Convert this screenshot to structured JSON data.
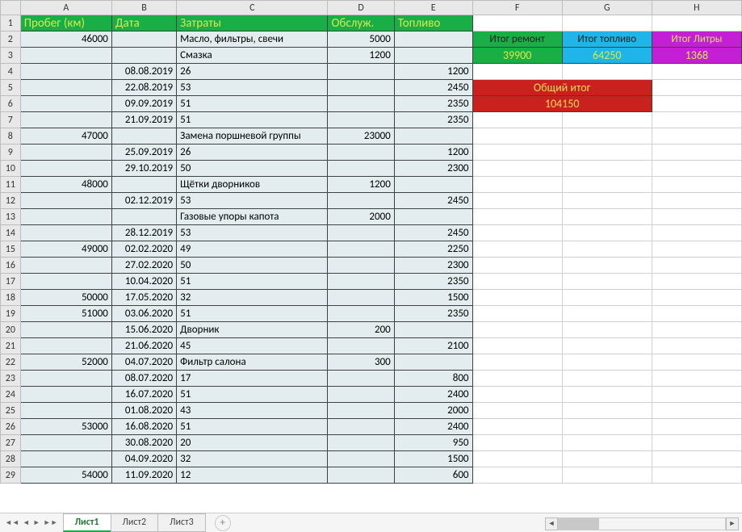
{
  "columns": [
    "A",
    "B",
    "C",
    "D",
    "E",
    "F",
    "G",
    "H"
  ],
  "header": {
    "A": "Пробег (км)",
    "B": "Дата",
    "C": "Затраты",
    "D": "Обслуж.",
    "E": "Топливо"
  },
  "rows": [
    {
      "r": 2,
      "A": "46000",
      "B": "",
      "C": "Масло, фильтры, свечи",
      "D": "5000",
      "E": ""
    },
    {
      "r": 3,
      "A": "",
      "B": "",
      "C": "Смазка",
      "D": "1200",
      "E": ""
    },
    {
      "r": 4,
      "A": "",
      "B": "08.08.2019",
      "C": "26",
      "D": "",
      "E": "1200"
    },
    {
      "r": 5,
      "A": "",
      "B": "22.08.2019",
      "C": "53",
      "D": "",
      "E": "2450"
    },
    {
      "r": 6,
      "A": "",
      "B": "09.09.2019",
      "C": "51",
      "D": "",
      "E": "2350"
    },
    {
      "r": 7,
      "A": "",
      "B": "21.09.2019",
      "C": "51",
      "D": "",
      "E": "2350"
    },
    {
      "r": 8,
      "A": "47000",
      "B": "",
      "C": "Замена поршневой группы",
      "D": "23000",
      "E": ""
    },
    {
      "r": 9,
      "A": "",
      "B": "25.09.2019",
      "C": "26",
      "D": "",
      "E": "1200"
    },
    {
      "r": 10,
      "A": "",
      "B": "29.10.2019",
      "C": "50",
      "D": "",
      "E": "2300"
    },
    {
      "r": 11,
      "A": "48000",
      "B": "",
      "C": "Щётки дворников",
      "D": "1200",
      "E": ""
    },
    {
      "r": 12,
      "A": "",
      "B": "02.12.2019",
      "C": "53",
      "D": "",
      "E": "2450"
    },
    {
      "r": 13,
      "A": "",
      "B": "",
      "C": "Газовые упоры капота",
      "D": "2000",
      "E": ""
    },
    {
      "r": 14,
      "A": "",
      "B": "28.12.2019",
      "C": "53",
      "D": "",
      "E": "2450"
    },
    {
      "r": 15,
      "A": "49000",
      "B": "02.02.2020",
      "C": "49",
      "D": "",
      "E": "2250"
    },
    {
      "r": 16,
      "A": "",
      "B": "27.02.2020",
      "C": "50",
      "D": "",
      "E": "2300"
    },
    {
      "r": 17,
      "A": "",
      "B": "10.04.2020",
      "C": "51",
      "D": "",
      "E": "2350"
    },
    {
      "r": 18,
      "A": "50000",
      "B": "17.05.2020",
      "C": "32",
      "D": "",
      "E": "1500"
    },
    {
      "r": 19,
      "A": "51000",
      "B": "03.06.2020",
      "C": "51",
      "D": "",
      "E": "2350"
    },
    {
      "r": 20,
      "A": "",
      "B": "15.06.2020",
      "C": "Дворник",
      "D": "200",
      "E": ""
    },
    {
      "r": 21,
      "A": "",
      "B": "21.06.2020",
      "C": "45",
      "D": "",
      "E": "2100"
    },
    {
      "r": 22,
      "A": "52000",
      "B": "04.07.2020",
      "C": "Фильтр салона",
      "D": "300",
      "E": ""
    },
    {
      "r": 23,
      "A": "",
      "B": "08.07.2020",
      "C": "17",
      "D": "",
      "E": "800"
    },
    {
      "r": 24,
      "A": "",
      "B": "16.07.2020",
      "C": "51",
      "D": "",
      "E": "2400"
    },
    {
      "r": 25,
      "A": "",
      "B": "01.08.2020",
      "C": "43",
      "D": "",
      "E": "2000"
    },
    {
      "r": 26,
      "A": "53000",
      "B": "16.08.2020",
      "C": "51",
      "D": "",
      "E": "2400"
    },
    {
      "r": 27,
      "A": "",
      "B": "30.08.2020",
      "C": "20",
      "D": "",
      "E": "950"
    },
    {
      "r": 28,
      "A": "",
      "B": "04.09.2020",
      "C": "32",
      "D": "",
      "E": "1500"
    },
    {
      "r": 29,
      "A": "54000",
      "B": "11.09.2020",
      "C": "12",
      "D": "",
      "E": "600"
    }
  ],
  "summary": {
    "repair_label": "Итог ремонт",
    "fuel_label": "Итог топливо",
    "liters_label": "Итог Литры",
    "repair_value": "39900",
    "fuel_value": "64250",
    "liters_value": "1368",
    "total_label": "Общий итог",
    "total_value": "104150"
  },
  "tabs": {
    "items": [
      "Лист1",
      "Лист2",
      "Лист3"
    ],
    "active": 0,
    "add_icon": "+"
  }
}
